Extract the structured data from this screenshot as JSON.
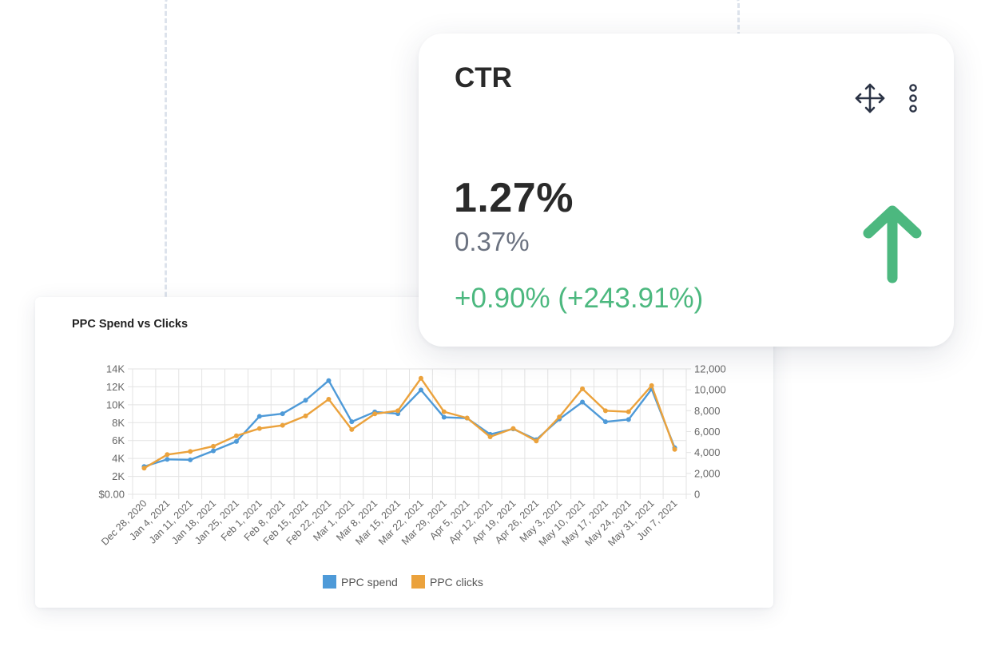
{
  "kpi": {
    "title": "CTR",
    "value": "1.27%",
    "previous": "0.37%",
    "change": "+0.90% (+243.91%)",
    "trend_icon": "arrow-up-icon",
    "trend_color": "#4cb87f",
    "actions": [
      "move-icon",
      "more-vertical-icon"
    ]
  },
  "chart_card": {
    "title": "PPC Spend vs Clicks"
  },
  "chart_data": {
    "type": "line",
    "title": "PPC Spend vs Clicks",
    "categories": [
      "Dec 28, 2020",
      "Jan 4, 2021",
      "Jan 11, 2021",
      "Jan 18, 2021",
      "Jan 25, 2021",
      "Feb 1, 2021",
      "Feb 8, 2021",
      "Feb 15, 2021",
      "Feb 22, 2021",
      "Mar 1, 2021",
      "Mar 8, 2021",
      "Mar 15, 2021",
      "Mar 22, 2021",
      "Mar 29, 2021",
      "Apr 5, 2021",
      "Apr 12, 2021",
      "Apr 19, 2021",
      "Apr 26, 2021",
      "May 3, 2021",
      "May 10, 2021",
      "May 17, 2021",
      "May 24, 2021",
      "May 31, 2021",
      "Jun 7, 2021"
    ],
    "series": [
      {
        "name": "PPC spend",
        "axis": "left",
        "color": "#4e9ad8",
        "values": [
          3100,
          3900,
          3850,
          4850,
          5900,
          8700,
          9000,
          10500,
          12700,
          8100,
          9200,
          9000,
          11650,
          8600,
          8500,
          6700,
          7300,
          6100,
          8400,
          10300,
          8100,
          8350,
          11750,
          5200
        ]
      },
      {
        "name": "PPC clicks",
        "axis": "right",
        "color": "#eba23c",
        "values": [
          2500,
          3800,
          4100,
          4600,
          5600,
          6300,
          6600,
          7500,
          9100,
          6200,
          7700,
          8000,
          11100,
          7900,
          7300,
          5500,
          6300,
          5100,
          7400,
          10100,
          8000,
          7900,
          10400,
          4300
        ]
      }
    ],
    "y_left": {
      "min": 0,
      "max": 14000,
      "ticks": [
        {
          "v": 0,
          "label": "$0.00"
        },
        {
          "v": 2000,
          "label": "2K"
        },
        {
          "v": 4000,
          "label": "4K"
        },
        {
          "v": 6000,
          "label": "6K"
        },
        {
          "v": 8000,
          "label": "8K"
        },
        {
          "v": 10000,
          "label": "10K"
        },
        {
          "v": 12000,
          "label": "12K"
        },
        {
          "v": 14000,
          "label": "14K"
        }
      ]
    },
    "y_right": {
      "min": 0,
      "max": 12000,
      "ticks": [
        {
          "v": 0,
          "label": "0"
        },
        {
          "v": 2000,
          "label": "2,000"
        },
        {
          "v": 4000,
          "label": "4,000"
        },
        {
          "v": 6000,
          "label": "6,000"
        },
        {
          "v": 8000,
          "label": "8,000"
        },
        {
          "v": 10000,
          "label": "10,000"
        },
        {
          "v": 12000,
          "label": "12,000"
        }
      ]
    },
    "grid": true,
    "legend": "bottom"
  }
}
